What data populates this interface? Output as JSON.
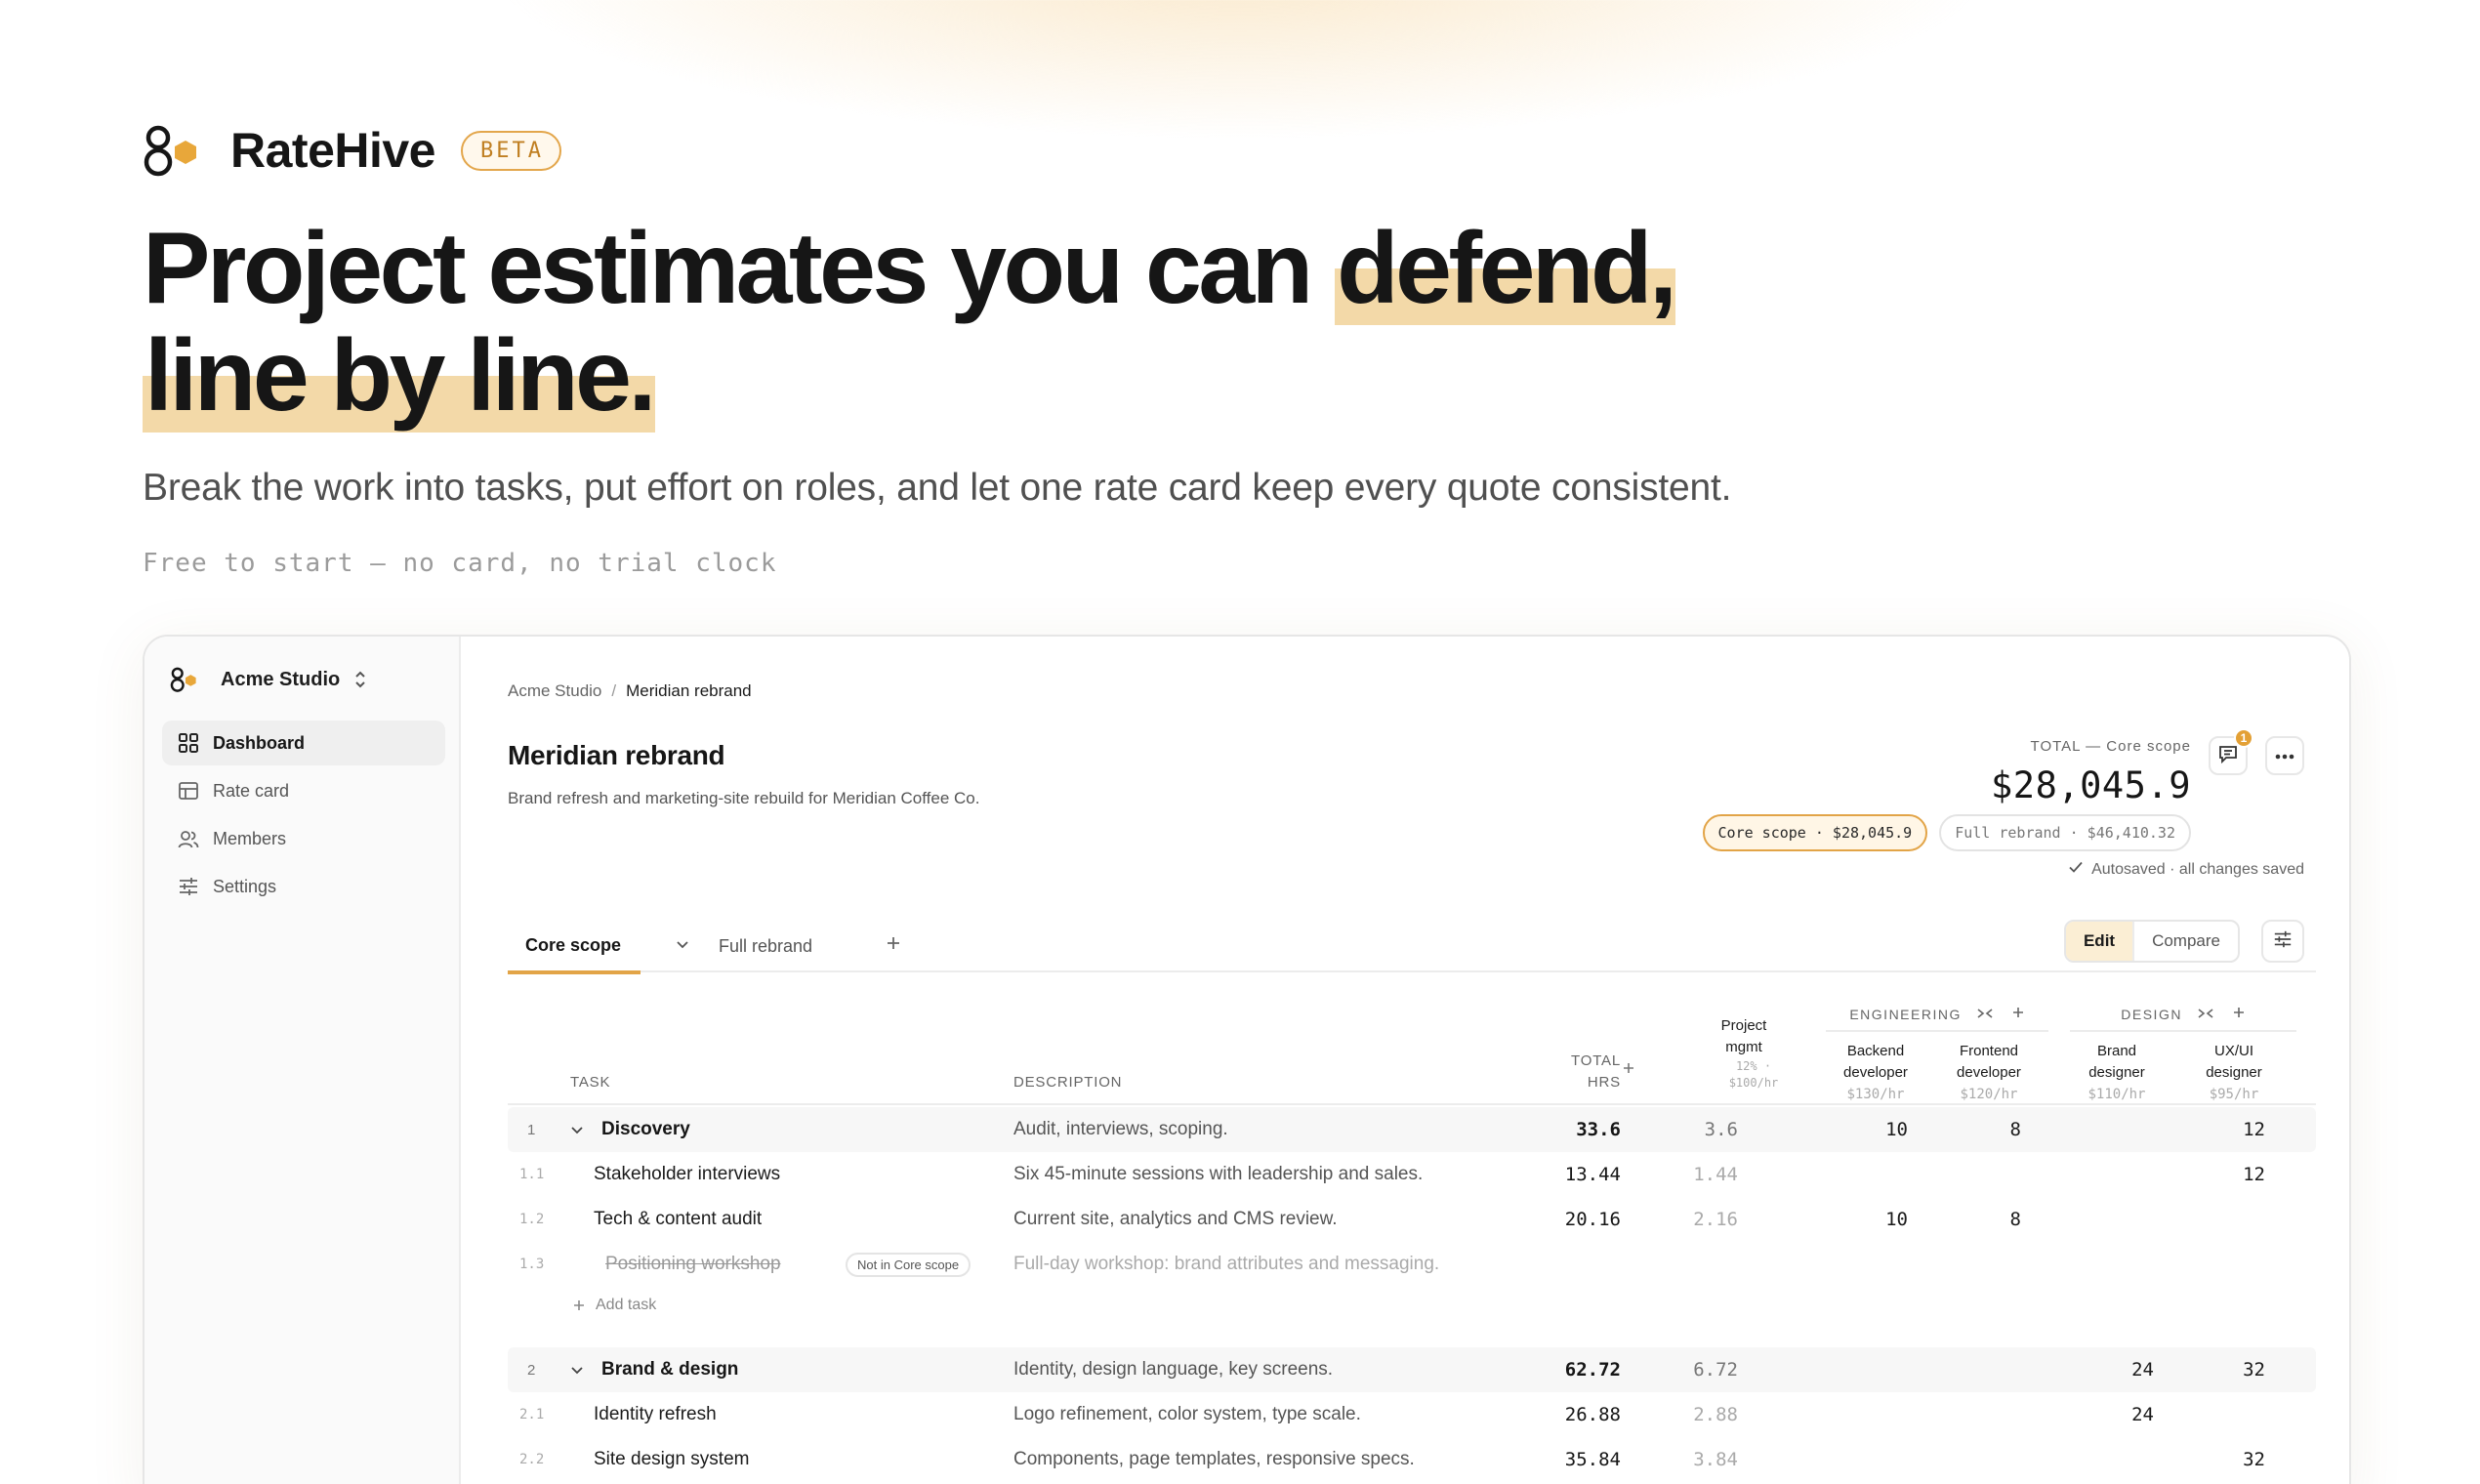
{
  "brand": {
    "name": "RateHive",
    "badge": "BETA"
  },
  "hero": {
    "headline_a": "Project estimates you can ",
    "headline_hl1": "defend,",
    "headline_hl2": "line by line.",
    "subline": "Break the work into tasks, put effort on roles, and let one rate card keep every quote consistent.",
    "free_line": "Free to start — no card, no trial clock"
  },
  "sidebar": {
    "workspace": "Acme Studio",
    "items": [
      {
        "label": "Dashboard",
        "icon": "grid-icon",
        "active": true
      },
      {
        "label": "Rate card",
        "icon": "table-icon",
        "active": false
      },
      {
        "label": "Members",
        "icon": "users-icon",
        "active": false
      },
      {
        "label": "Settings",
        "icon": "sliders-icon",
        "active": false
      }
    ]
  },
  "breadcrumb": {
    "parent": "Acme Studio",
    "separator": "/",
    "current": "Meridian rebrand"
  },
  "project": {
    "title": "Meridian rebrand",
    "description": "Brand refresh and marketing-site rebuild for Meridian Coffee Co."
  },
  "total": {
    "label": "TOTAL — Core scope",
    "value": "$28,045.9"
  },
  "notifications": {
    "count": "1"
  },
  "scenarios": [
    {
      "label": "Core scope · $28,045.9",
      "active": true
    },
    {
      "label": "Full rebrand · $46,410.32",
      "active": false
    }
  ],
  "autosave": {
    "text": "Autosaved · all changes saved"
  },
  "tabs": [
    {
      "label": "Core scope",
      "active": true
    },
    {
      "label": "Full rebrand",
      "active": false
    }
  ],
  "view_toggle": {
    "edit": "Edit",
    "compare": "Compare"
  },
  "table": {
    "headers": {
      "task": "TASK",
      "description": "DESCRIPTION",
      "total_line1": "TOTAL",
      "total_line2": "HRS",
      "group_engineering": "ENGINEERING",
      "group_design": "DESIGN",
      "pm_line1": "Project",
      "pm_line2": "mgmt",
      "pm_rate": "12% · $100/hr",
      "backend_line1": "Backend",
      "backend_line2": "developer",
      "backend_rate": "$130/hr",
      "frontend_line1": "Frontend",
      "frontend_line2": "developer",
      "frontend_rate": "$120/hr",
      "brand_line1": "Brand",
      "brand_line2": "designer",
      "brand_rate": "$110/hr",
      "ux_line1": "UX/UI",
      "ux_line2": "designer",
      "ux_rate": "$95/hr"
    },
    "excluded_label": "Not in Core scope",
    "add_task": "Add task",
    "rows": [
      {
        "n": "1",
        "task": "Discovery",
        "desc": "Audit, interviews, scoping.",
        "total": "33.6",
        "pm": "3.6",
        "backend": "10",
        "frontend": "8",
        "brand": "",
        "ux": "12"
      },
      {
        "n": "1.1",
        "task": "Stakeholder interviews",
        "desc": "Six 45-minute sessions with leadership and sales.",
        "total": "13.44",
        "pm": "1.44",
        "backend": "",
        "frontend": "",
        "brand": "",
        "ux": "12"
      },
      {
        "n": "1.2",
        "task": "Tech & content audit",
        "desc": "Current site, analytics and CMS review.",
        "total": "20.16",
        "pm": "2.16",
        "backend": "10",
        "frontend": "8",
        "brand": "",
        "ux": ""
      },
      {
        "n": "1.3",
        "task": "Positioning workshop",
        "desc": "Full-day workshop: brand attributes and messaging."
      },
      {
        "n": "2",
        "task": "Brand & design",
        "desc": "Identity, design language, key screens.",
        "total": "62.72",
        "pm": "6.72",
        "backend": "",
        "frontend": "",
        "brand": "24",
        "ux": "32"
      },
      {
        "n": "2.1",
        "task": "Identity refresh",
        "desc": "Logo refinement, color system, type scale.",
        "total": "26.88",
        "pm": "2.88",
        "backend": "",
        "frontend": "",
        "brand": "24",
        "ux": ""
      },
      {
        "n": "2.2",
        "task": "Site design system",
        "desc": "Components, page templates, responsive specs.",
        "total": "35.84",
        "pm": "3.84",
        "backend": "",
        "frontend": "",
        "brand": "",
        "ux": "32"
      }
    ]
  },
  "colors": {
    "accent": "#e2a447",
    "accent_soft": "#f3d9a8",
    "text": "#161616",
    "muted": "#666666"
  }
}
